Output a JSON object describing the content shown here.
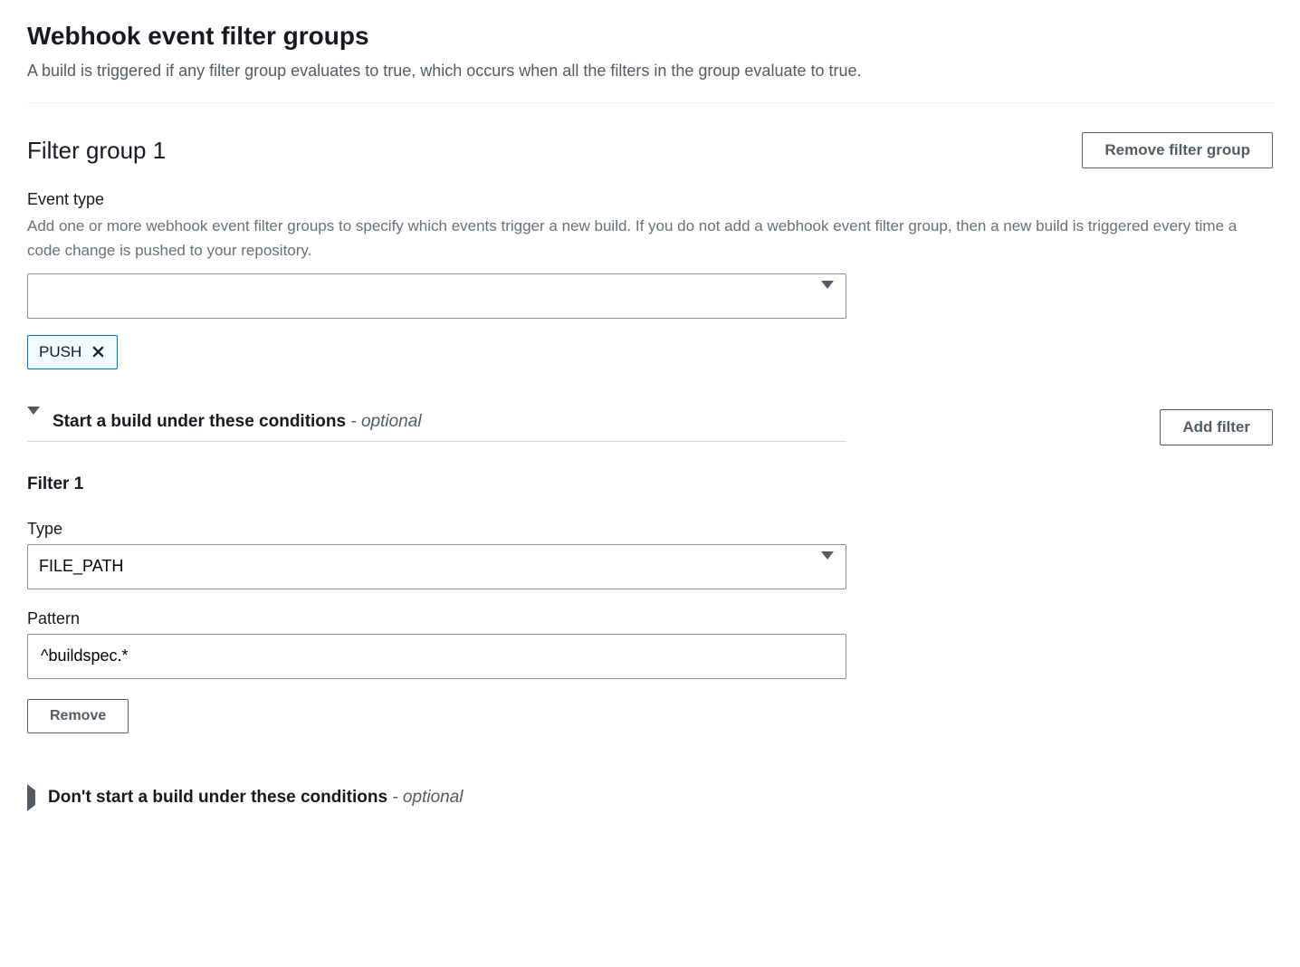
{
  "header": {
    "title": "Webhook event filter groups",
    "description": "A build is triggered if any filter group evaluates to true, which occurs when all the filters in the group evaluate to true."
  },
  "filterGroup": {
    "title": "Filter group 1",
    "removeButton": "Remove filter group",
    "eventType": {
      "label": "Event type",
      "description": "Add one or more webhook event filter groups to specify which events trigger a new build. If you do not add a webhook event filter group, then a new build is triggered every time a code change is pushed to your repository.",
      "selectedValue": "",
      "tokens": [
        "PUSH"
      ]
    }
  },
  "startBuild": {
    "accordionLabel": "Start a build under these conditions",
    "optionalLabel": "- optional",
    "addFilterButton": "Add filter",
    "filters": [
      {
        "title": "Filter 1",
        "typeLabel": "Type",
        "typeValue": "FILE_PATH",
        "patternLabel": "Pattern",
        "patternValue": "^buildspec.*",
        "removeButton": "Remove"
      }
    ]
  },
  "dontStartBuild": {
    "accordionLabel": "Don't start a build under these conditions",
    "optionalLabel": "- optional"
  }
}
